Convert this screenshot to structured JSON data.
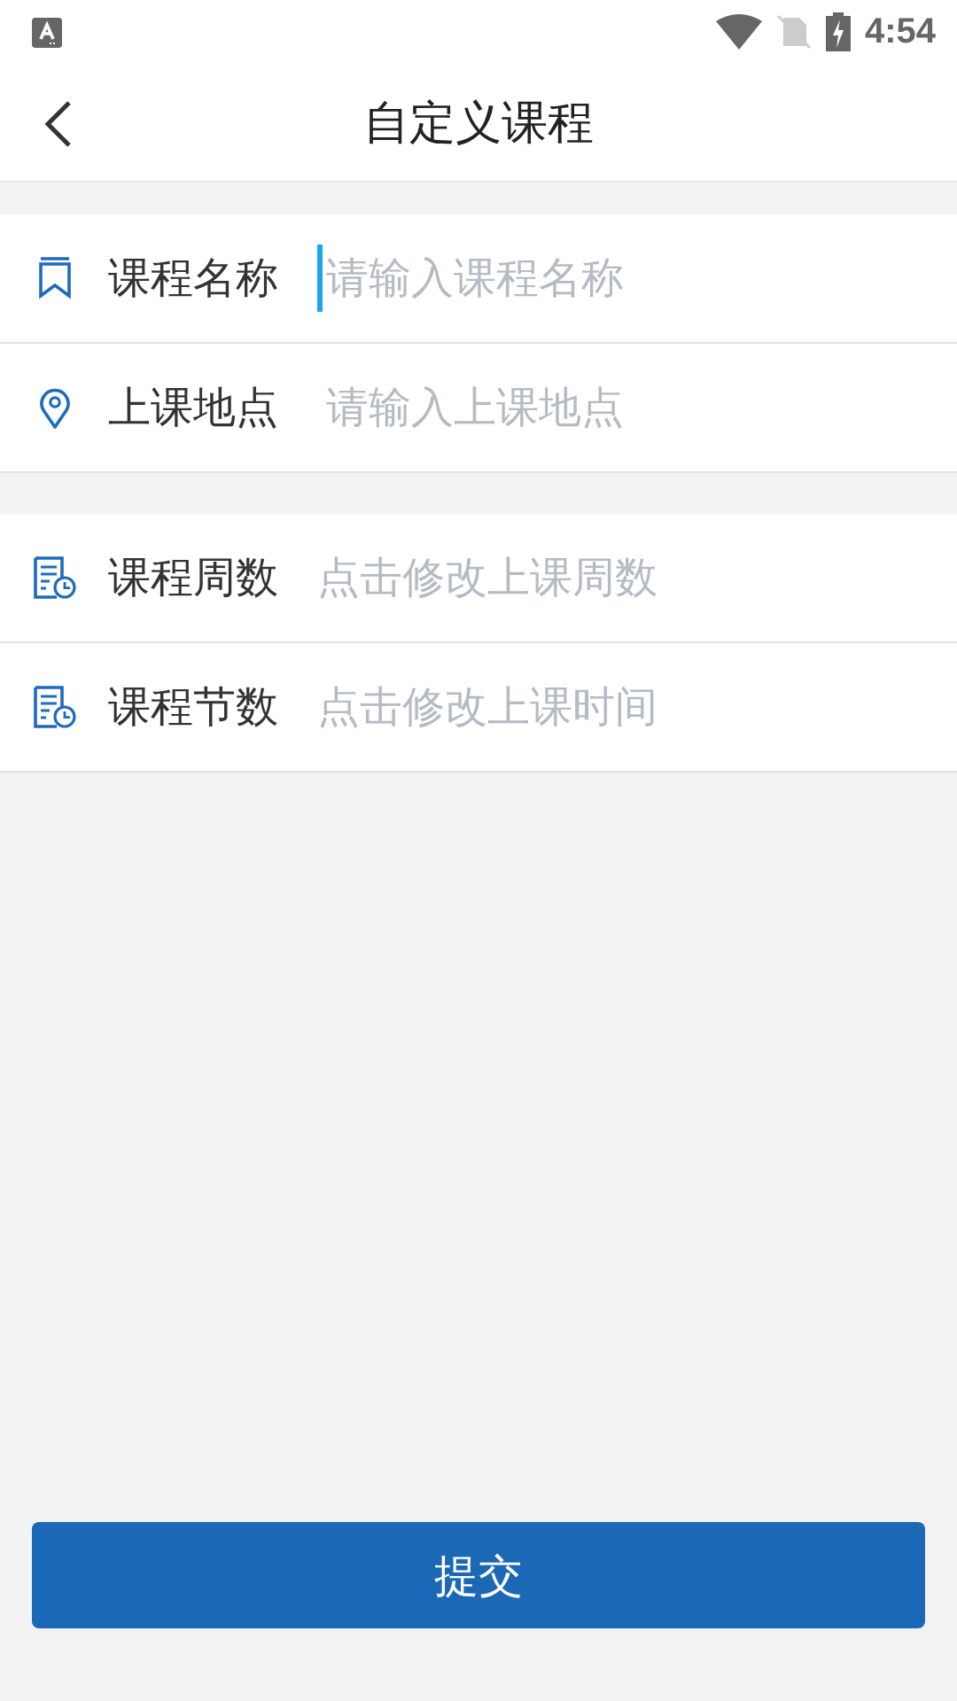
{
  "status_bar": {
    "time": "4:54"
  },
  "header": {
    "title": "自定义课程"
  },
  "sections": [
    {
      "rows": [
        {
          "kind": "input",
          "label": "课程名称",
          "placeholder": "请输入课程名称",
          "focused": true
        },
        {
          "kind": "input",
          "label": "上课地点",
          "placeholder": "请输入上课地点",
          "focused": false
        }
      ]
    },
    {
      "rows": [
        {
          "kind": "picker",
          "label": "课程周数",
          "placeholder": "点击修改上课周数"
        },
        {
          "kind": "picker",
          "label": "课程节数",
          "placeholder": "点击修改上课时间"
        }
      ]
    }
  ],
  "submit": {
    "label": "提交"
  }
}
